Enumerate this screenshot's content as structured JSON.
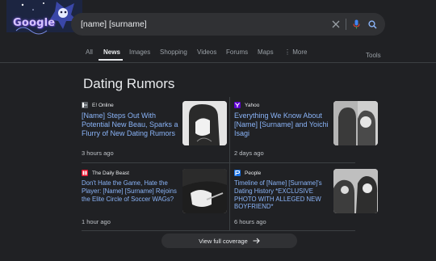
{
  "search": {
    "logo_text": "Google",
    "query": "[name] [surname]"
  },
  "tabs": [
    {
      "label": "All"
    },
    {
      "label": "News"
    },
    {
      "label": "Images"
    },
    {
      "label": "Shopping"
    },
    {
      "label": "Videos"
    },
    {
      "label": "Forums"
    },
    {
      "label": "Maps"
    },
    {
      "label": "More"
    }
  ],
  "tools_label": "Tools",
  "section_title": "Dating Rumors",
  "articles": [
    {
      "source": "E! Online",
      "source_icon": "eonline-icon",
      "source_color": "#5f6368",
      "headline": "[Name] Steps Out With Potential New Beau, Sparks a Flurry of New Dating Rumors",
      "age": "3 hours ago"
    },
    {
      "source": "Yahoo",
      "source_icon": "yahoo-icon",
      "source_color": "#6001d2",
      "headline": "Everything We Know About [Name] [Surname] and Yoichi Isagi",
      "age": "2 days ago"
    },
    {
      "source": "The Daily Beast",
      "source_icon": "daily-beast-icon",
      "source_color": "#e8112d",
      "headline": "Don't Hate the Game, Hate the Player: [Name] [Surname] Rejoins the Elite Circle of Soccer WAGs?",
      "age": "1 hour ago"
    },
    {
      "source": "People",
      "source_icon": "people-icon",
      "source_color": "#1a73e8",
      "headline": "Timeline of [Name] [Surname]'s Dating History *EXCLUSIVE PHOTO WITH ALLEGED NEW BOYFRIEND*",
      "age": "6 hours ago"
    }
  ],
  "coverage_label": "View full coverage"
}
